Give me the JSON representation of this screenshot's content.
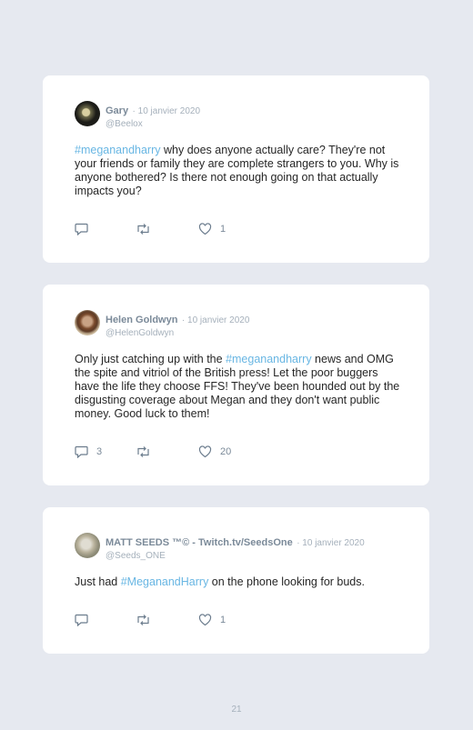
{
  "tweets": [
    {
      "name": "Gary",
      "date": "· 10 janvier 2020",
      "handle": "@Beelox",
      "text_parts": [
        "#meganandharry",
        " why does anyone actually care? They're not your friends or family they are complete strangers to you. Why is anyone bothered? Is there not enough going on that actually impacts you?"
      ],
      "replies": "",
      "likes": "1"
    },
    {
      "name": "Helen Goldwyn",
      "date": "· 10 janvier 2020",
      "handle": "@HelenGoldwyn",
      "text_parts": [
        "Only just catching up with the ",
        "#meganandharry",
        " news and OMG the spite and vitriol of the British press! Let the poor buggers have the life they choose FFS! They've been hounded out by the disgusting coverage about Megan and they don't want public money. Good luck to them!"
      ],
      "replies": "3",
      "likes": "20"
    },
    {
      "name": "MATT SEEDS ™© - Twitch.tv/SeedsOne",
      "date": "· 10 janvier 2020",
      "handle": "@Seeds_ONE",
      "text_parts": [
        "Just had ",
        "#MeganandHarry",
        " on the phone looking for buds."
      ],
      "replies": "",
      "likes": "1"
    }
  ],
  "page_number": "21"
}
